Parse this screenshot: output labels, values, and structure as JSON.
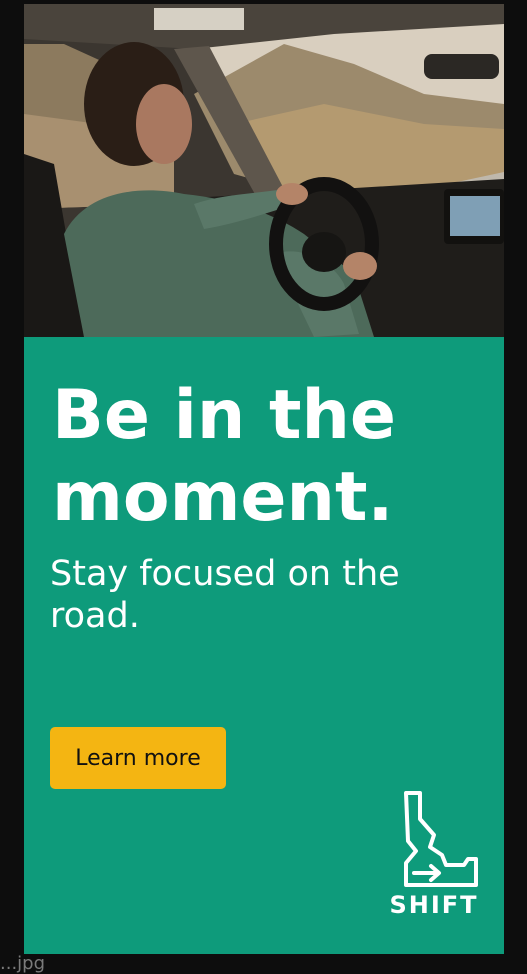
{
  "ad": {
    "headline": "Be in the moment.",
    "subhead": "Stay focused on the road.",
    "cta_label": "Learn more",
    "brand": "SHIFT"
  },
  "filename": "...jpg",
  "colors": {
    "panel": "#0e9b7b",
    "button": "#f4b512",
    "text": "#ffffff",
    "button_text": "#111111"
  },
  "icons": {
    "logo": "idaho-state-outline-arrow-icon"
  }
}
